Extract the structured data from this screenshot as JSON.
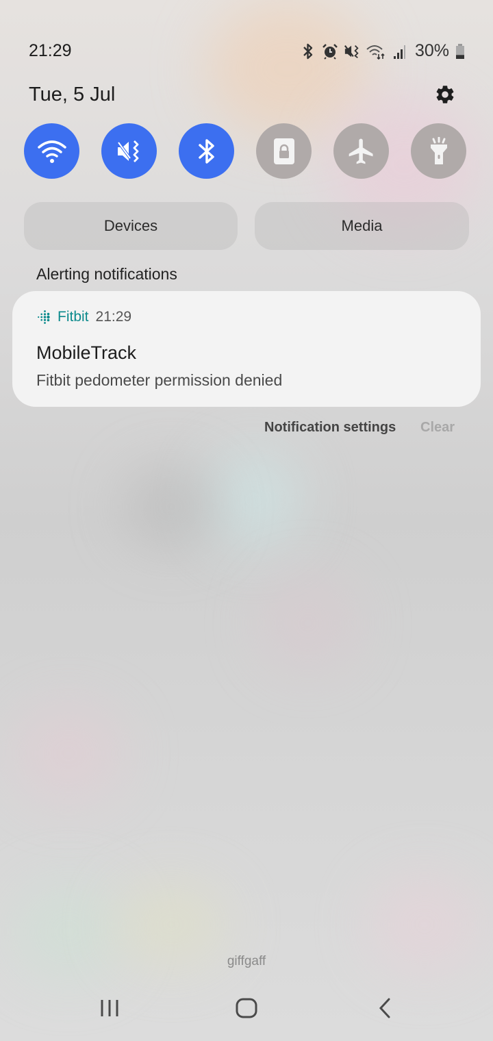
{
  "status_bar": {
    "time": "21:29",
    "icons": [
      "bluetooth-icon",
      "alarm-icon",
      "vibrate-mute-icon",
      "wifi-data-icon",
      "signal-icon"
    ],
    "battery_percent_label": "30%",
    "battery_level": 0.3
  },
  "header": {
    "date": "Tue, 5 Jul",
    "settings_icon": "gear-icon"
  },
  "quick_settings": [
    {
      "name": "wifi",
      "icon": "wifi-icon",
      "state": "on"
    },
    {
      "name": "mute",
      "icon": "mute-vibrate-icon",
      "state": "on"
    },
    {
      "name": "bluetooth",
      "icon": "bluetooth-icon",
      "state": "on"
    },
    {
      "name": "screen-lock",
      "icon": "lock-icon",
      "state": "off"
    },
    {
      "name": "airplane",
      "icon": "airplane-icon",
      "state": "off"
    },
    {
      "name": "flashlight",
      "icon": "flashlight-icon",
      "state": "off"
    }
  ],
  "pills": {
    "devices": "Devices",
    "media": "Media"
  },
  "section_label": "Alerting notifications",
  "notification": {
    "app_name": "Fitbit",
    "time": "21:29",
    "title": "MobileTrack",
    "body": "Fitbit pedometer permission denied"
  },
  "actions": {
    "settings": "Notification settings",
    "clear": "Clear"
  },
  "carrier": "giffgaff",
  "colors": {
    "accent": "#3c6ff0",
    "inactive_tile": "#b0aaa9",
    "fitbit_teal": "#0b8a8c"
  }
}
